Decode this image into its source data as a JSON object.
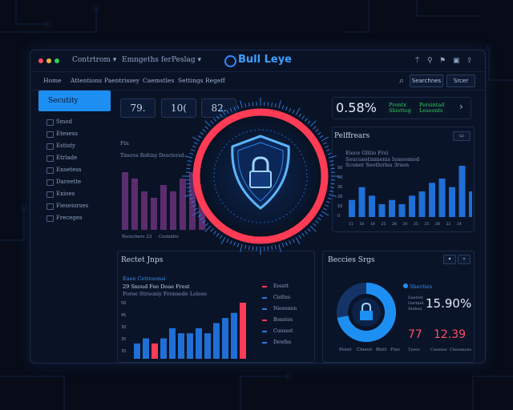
{
  "app": {
    "title": "Bull Leye"
  },
  "titlebar": {
    "menus": [
      "Contrtrom ▾",
      "Emngeths fer",
      "Peslag ▾"
    ],
    "dots": [
      "#ff4d5e",
      "#ffb340",
      "#2ecc5f"
    ]
  },
  "nav": {
    "items": [
      "Home",
      "Attentions",
      "Paentrissey",
      "Caemstles",
      "Settings",
      "Regeff"
    ],
    "search_label": "Searchnes",
    "secondary_label": "Srcer"
  },
  "sidebar": {
    "active": "Secutity",
    "items": [
      "Smod",
      "Etesess",
      "Estisty",
      "Etrlade",
      "Ensetess",
      "Dareette",
      "Exioes",
      "Fieseiorses",
      "Freceges"
    ]
  },
  "stats": {
    "a": "79.",
    "b": "10(",
    "c": "82."
  },
  "card_right": {
    "percent": "0.58%",
    "green_a": "Prontx\nShiettog",
    "green_b": "Persintad\nLeseonts"
  },
  "left_chart": {
    "label_short": "Fin",
    "label": "Tineres Roltiny Deoctersd",
    "legend": [
      "Rscechers 23",
      "Cesteilrs"
    ],
    "values": [
      9,
      8,
      6,
      5,
      7,
      6,
      8,
      9,
      7
    ]
  },
  "right_chart": {
    "title": "Pelffrears",
    "subtitle": "Eiece Glitio Frsi",
    "note": "Seucuestinmenis Ismeomod\nSconer Seotlerisa 3rsen",
    "ylabels": [
      "50",
      "40",
      "30",
      "20",
      "10",
      "0"
    ],
    "xlabels": [
      "11",
      "16",
      "18",
      "25",
      "28",
      "20",
      "25",
      "25",
      "28",
      "22",
      "24"
    ],
    "values": [
      4,
      7,
      5,
      3,
      4,
      3,
      5,
      6,
      8,
      9,
      7,
      12,
      6
    ]
  },
  "bottom_left": {
    "title": "Rectet Jnps",
    "subtitle": "Eaee Cetresonsi",
    "stat_line": "29 Snoud Fee Doae Frest",
    "stat_line2": "Foree Streoniy Fronsede Lelese",
    "y_labels": [
      "50",
      "45",
      "30",
      "35",
      "35"
    ],
    "values": [
      3,
      4,
      3,
      4,
      6,
      5,
      5,
      6,
      5,
      7,
      8,
      9,
      11
    ],
    "highlight": [
      2,
      12
    ],
    "legend": [
      "Eesstt",
      "Cieltes",
      "Nieeenen",
      "Bonstes",
      "Cunsset",
      "Dewfes"
    ]
  },
  "bottom_right": {
    "title": "Beccies Srgs",
    "legend_title": "Shecties",
    "legend_lines": [
      "Eaeriet",
      "Gertnet",
      "Stehes"
    ],
    "percent": "15.90%",
    "num_a": "77",
    "num_b": "12.39",
    "bottom_labels": [
      "Feeet",
      "Cheest",
      "Blett",
      "Fies"
    ],
    "cap_a": "Tyees",
    "cap_b": "Cesenss",
    "cap_c": "Chesenoss",
    "donut_fraction": 0.72
  },
  "colors": {
    "accent": "#1e8ff2",
    "alert": "#ff3b55",
    "bar_blue": "#1f6fd6",
    "bar_purple": "#5b2d6e"
  }
}
